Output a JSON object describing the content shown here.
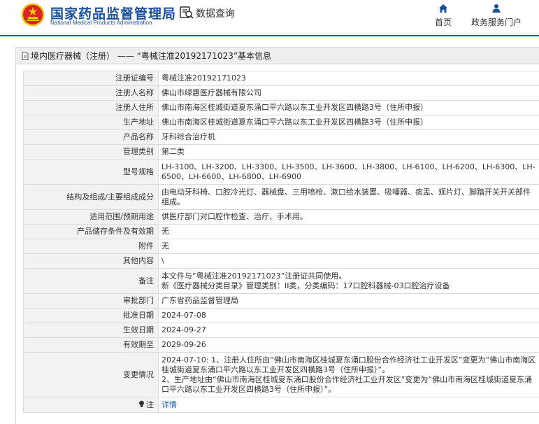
{
  "header": {
    "title": "国家药品监督管理局",
    "subtitle": "National Medical Products Administration",
    "section": "数据查询",
    "nav": {
      "home": "首页",
      "portal": "政务服务门户"
    }
  },
  "colors": {
    "brand": "#1a4f9a",
    "emblem_red": "#d7261e",
    "emblem_gold": "#f4c21a",
    "link": "#1a5fb4"
  },
  "panel": {
    "title": "境内医疗器械（注册） —— “粤械注准20192171023”基本信息"
  },
  "rows": [
    {
      "label": "注册证编号",
      "value": "粤械注准20192171023"
    },
    {
      "label": "注册人名称",
      "value": "佛山市绿惠医疗器械有限公司"
    },
    {
      "label": "注册人住所",
      "value": "佛山市南海区桂城街道夏东涌口平六路以东工业开发区四横路3号（住所申报）"
    },
    {
      "label": "生产地址",
      "value": "佛山市南海区桂城街道夏东涌口平六路以东工业开发区四横路3号（住所申报）"
    },
    {
      "label": "产品名称",
      "value": "牙科综合治疗机"
    },
    {
      "label": "管理类别",
      "value": "第二类"
    },
    {
      "label": "型号规格",
      "value": "LH-3100、LH-3200、LH-3300、LH-3500、LH-3600、LH-3800、LH-6100、LH-6200、LH-6300、LH-6500、LH-6600、LH-6800、LH-6900"
    },
    {
      "label": "结构及组成/主要组成成分",
      "value": "由电动牙科椅、口腔冷光灯、器械盘、三用喷枪、漱口给水装置、吸唾器、痰盂、观片灯、脚踏开关开关部件组成。"
    },
    {
      "label": "适用范围/预期用途",
      "value": "供医疗部门对口腔作检查、治疗、手术用。"
    },
    {
      "label": "产品储存条件及有效期",
      "value": "无"
    },
    {
      "label": "附件",
      "value": "无"
    },
    {
      "label": "其他内容",
      "value": "\\"
    },
    {
      "label": "备注",
      "lines": [
        "本文件与“粤械注准20192171023”注册证共同使用。",
        "新《医疗器械分类目录》管理类别：II类，分类编码：17口腔科器械-03口腔治疗设备"
      ]
    },
    {
      "label": "审批部门",
      "value": "广东省药品监督管理局"
    },
    {
      "label": "批准日期",
      "value": "2024-07-08"
    },
    {
      "label": "生效日期",
      "value": "2024-09-27"
    },
    {
      "label": "有效期至",
      "value": "2029-09-26"
    },
    {
      "label": "变更情况",
      "lines": [
        "2024-07-10: 1、注册人住所由“佛山市南海区桂城夏东涌口股份合作经济社工业开发区”变更为“佛山市南海区桂城街道夏东涌口平六路以东工业开发区四横路3号（住所申报）”。",
        "2、生产地址由“佛山市南海区桂城夏东涌口股份合作经济社工业开发区”变更为“佛山市南海区桂城街道夏东涌口平六路以东工业开发区四横路3号（住所申报）”。"
      ]
    },
    {
      "label": "注",
      "link": "详情",
      "icon": "lightbulb-icon"
    }
  ]
}
